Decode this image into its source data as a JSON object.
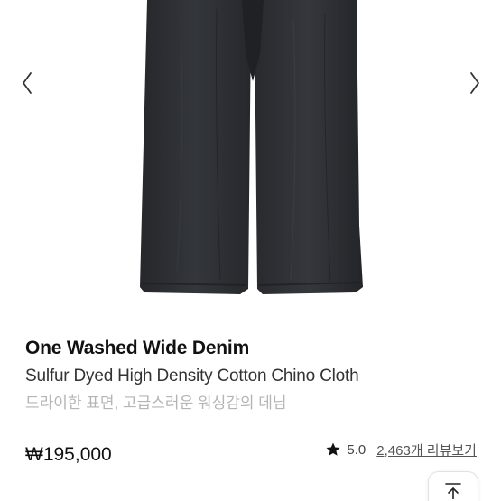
{
  "gallery": {
    "prev_icon": "chevron-left-icon",
    "next_icon": "chevron-right-icon",
    "product_color": "#2a2c31"
  },
  "product": {
    "title": "One Washed Wide Denim",
    "subtitle": "Sulfur Dyed High Density Cotton Chino Cloth",
    "description": "드라이한 표면, 고급스러운 워싱감의 데님",
    "price": "₩195,000",
    "rating": "5.0",
    "reviews_link": "2,463개 리뷰보기",
    "rating_icon": "star-icon"
  },
  "scroll_top": {
    "icon": "arrow-up-to-top-icon"
  }
}
